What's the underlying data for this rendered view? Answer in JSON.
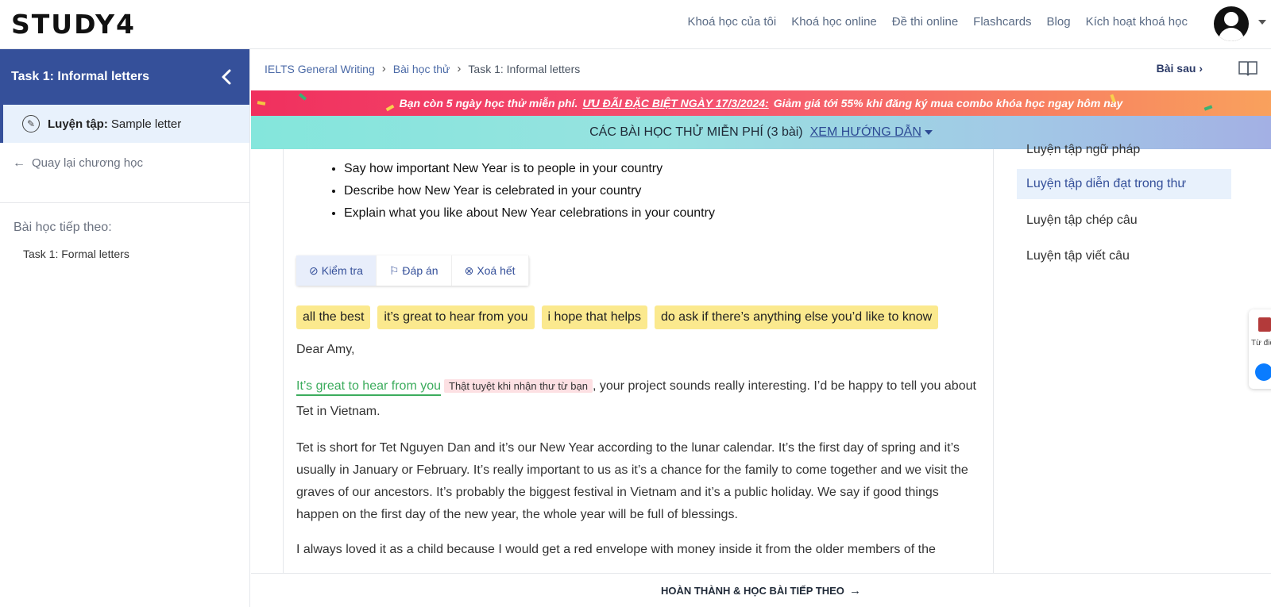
{
  "header": {
    "logo": "STUDY4",
    "nav": [
      "Khoá học của tôi",
      "Khoá học online",
      "Đề thi online",
      "Flashcards",
      "Blog",
      "Kích hoạt khoá học"
    ]
  },
  "sidebar": {
    "title": "Task 1: Informal letters",
    "current_item_prefix": "Luyện tập:",
    "current_item_label": "Sample letter",
    "back_label": "Quay lại chương học",
    "next_heading": "Bài học tiếp theo:",
    "next_item": "Task 1: Formal letters"
  },
  "breadcrumb": {
    "items": [
      "IELTS General Writing",
      "Bài học thử",
      "Task 1: Informal letters"
    ],
    "next_lesson": "Bài sau"
  },
  "promo": {
    "lead": "Bạn còn 5 ngày học thử miễn phí.",
    "highlight": "ƯU ĐÃI ĐẶC BIỆT NGÀY 17/3/2024:",
    "tail": "Giảm giá tới 55% khi đăng ký mua combo khóa học ngay hôm nay"
  },
  "free_lessons": {
    "text": "CÁC BÀI HỌC THỬ MIỄN PHÍ (3 bài)",
    "guide": "XEM HƯỚNG DẪN"
  },
  "task": {
    "bullets": [
      "Say how important New Year is to people in your country",
      "Describe how New Year is celebrated in your country",
      "Explain what you like about New Year celebrations in your country"
    ]
  },
  "toolbar": {
    "check": "Kiểm tra",
    "answer": "Đáp án",
    "clear": "Xoá hết"
  },
  "chips": [
    "all the best",
    "it’s great to hear from you",
    "i hope that helps",
    "do ask if there’s anything else you’d like to know"
  ],
  "letter": {
    "greeting": "Dear Amy,",
    "filled_answer": "It’s great to hear from you",
    "translation": "Thật tuyệt khi nhận thư từ bạn",
    "p1_rest": ", your project sounds really interesting. I’d be happy to tell you about Tet in Vietnam.",
    "p2": "Tet is short for Tet Nguyen Dan and it’s our New Year according to the lunar calendar. It’s the first day of spring and it’s usually in January or February. It’s really important to us as it’s a chance for the family to come together and we visit the graves of our ancestors. It’s probably the biggest festival in Vietnam and it’s a public holiday. We say if good things happen on the first day of the new year, the whole year will be full of blessings.",
    "p3": "I always loved it as a child because I would get a red envelope with money inside it from the older members of the"
  },
  "right_panel": {
    "items": [
      {
        "label": "Luyện tập ngữ pháp"
      },
      {
        "label": "Luyện tập diễn đạt trong thư"
      },
      {
        "label": "Luyện tập chép câu"
      },
      {
        "label": "Luyện tập viết câu"
      }
    ],
    "widget_label": "Từ điển"
  },
  "footer": {
    "complete": "HOÀN THÀNH & HỌC BÀI TIẾP THEO"
  }
}
